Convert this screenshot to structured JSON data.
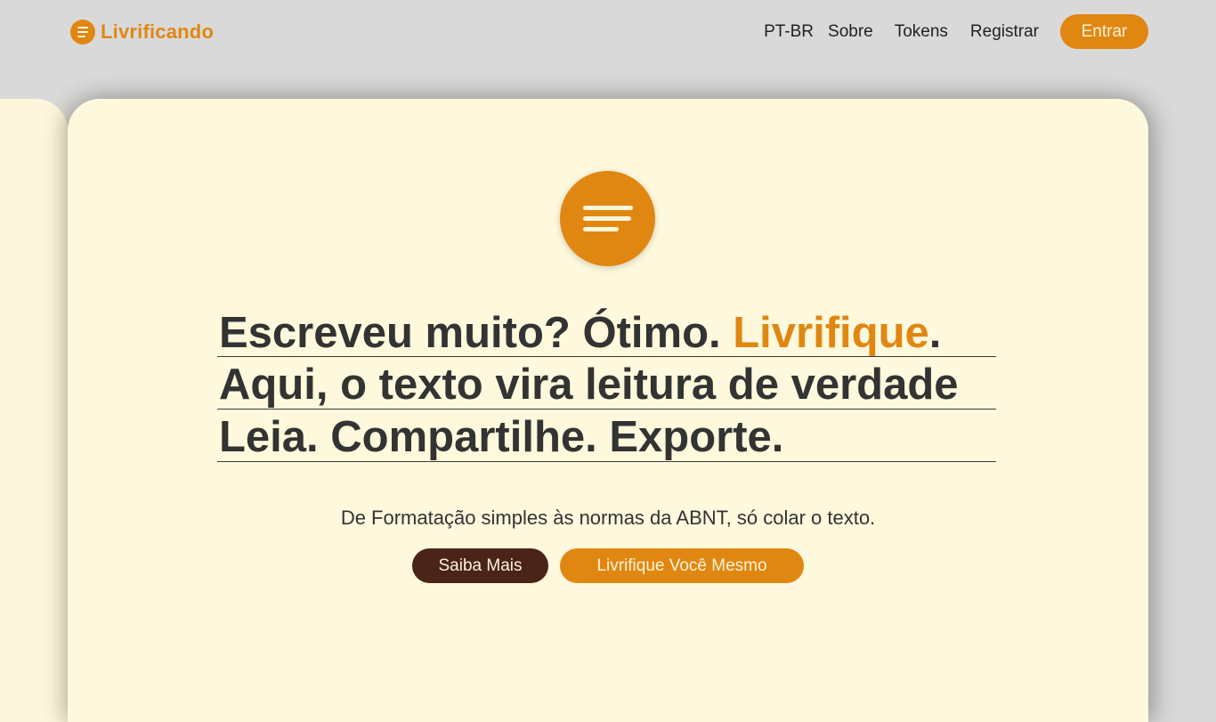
{
  "header": {
    "brand": "Livrificando",
    "nav": {
      "language": "PT-BR",
      "about": "Sobre",
      "tokens": "Tokens",
      "register": "Registrar",
      "login": "Entrar"
    }
  },
  "hero": {
    "headline": {
      "line1_part1": "Escreveu muito? Ótimo. ",
      "line1_accent": "Livrifique",
      "line1_end": ".",
      "line2": "Aqui, o texto vira leitura de verdade",
      "line3": "Leia. Compartilhe. Exporte."
    },
    "subtitle": "De Formatação simples às normas da ABNT, só colar o texto.",
    "buttons": {
      "learn_more": "Saiba Mais",
      "try_it": "Livrifique Você Mesmo"
    }
  },
  "colors": {
    "accent": "#e08712",
    "dark_button": "#4a2418",
    "page": "#fef8dc",
    "background": "#d9d9d9"
  }
}
